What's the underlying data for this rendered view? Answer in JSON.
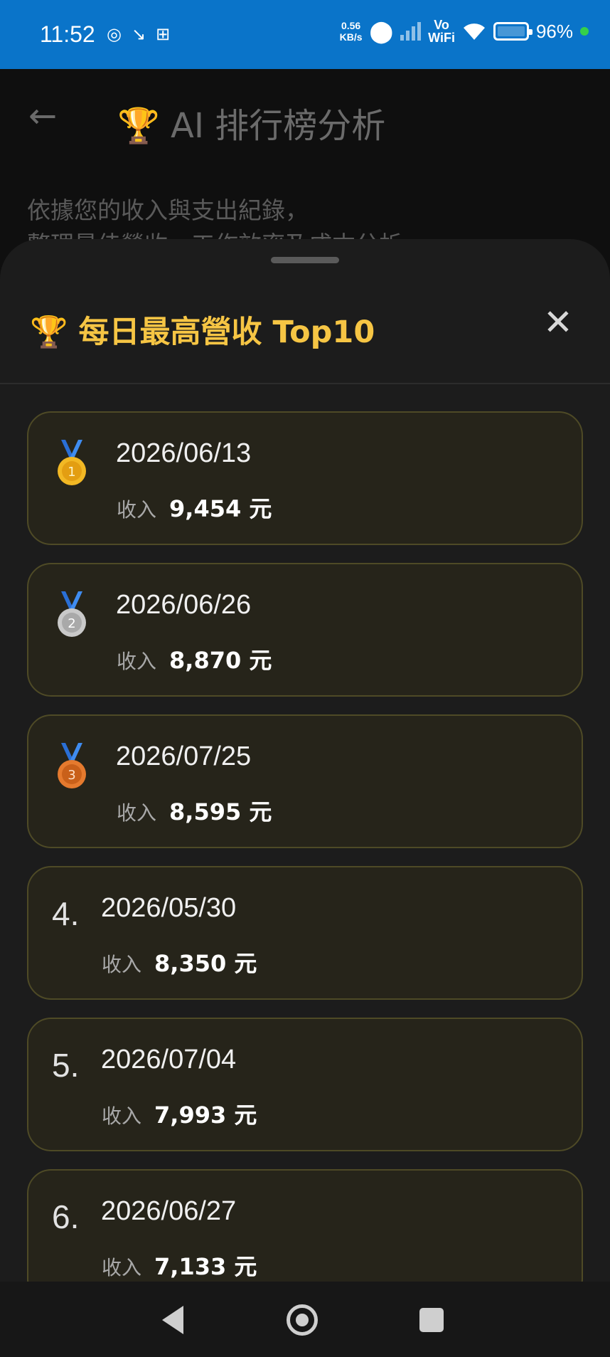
{
  "status_bar": {
    "time": "11:52",
    "net_speed_value": "0.56",
    "net_speed_unit": "KB/s",
    "vowifi_top": "Vo",
    "vowifi_bottom": "WiFi",
    "battery": "96%"
  },
  "app": {
    "back_icon": "back-arrow-icon",
    "title": "🏆 AI 排行榜分析",
    "description_line1": "依據您的收入與支出紀錄，",
    "description_line2": "整理最佳營收、工作效率及成本分析。"
  },
  "sheet": {
    "title": "🏆 每日最高營收 Top10",
    "close_label": "✕",
    "income_label": "收入",
    "currency": "元",
    "items": [
      {
        "rank": "1",
        "date": "2026/06/13",
        "income": "9,454 元",
        "medal": "gold"
      },
      {
        "rank": "2",
        "date": "2026/06/26",
        "income": "8,870 元",
        "medal": "silver"
      },
      {
        "rank": "3",
        "date": "2026/07/25",
        "income": "8,595 元",
        "medal": "bronze"
      },
      {
        "rank": "4.",
        "date": "2026/05/30",
        "income": "8,350 元"
      },
      {
        "rank": "5.",
        "date": "2026/07/04",
        "income": "7,993 元"
      },
      {
        "rank": "6.",
        "date": "2026/06/27",
        "income": "7,133 元"
      }
    ]
  },
  "colors": {
    "status_bar": "#0a74c9",
    "accent_gold": "#f6c544",
    "card_bg": "#26241a",
    "card_border": "#4e4a26"
  }
}
